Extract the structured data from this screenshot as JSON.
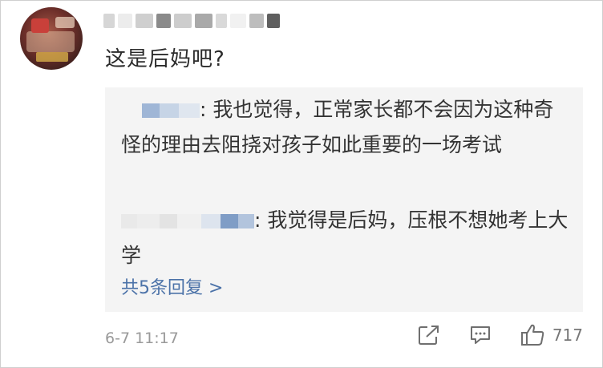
{
  "comment": {
    "text": "这是后妈吧?",
    "timestamp": "6-7  11:17",
    "like_count": "717"
  },
  "replies": [
    {
      "text": ": 我也觉得，正常家长都不会因为这种奇怪的理由去阻挠对孩子如此重要的一场考试"
    },
    {
      "text": ": 我觉得是后妈，压根不想她考上大学"
    }
  ],
  "more_replies_label": "共5条回复 >",
  "icons": {
    "share": "share-icon",
    "reply": "comment-icon",
    "like": "thumbs-up-icon"
  },
  "colors": {
    "link": "#4b72a8",
    "reply_bg": "#f4f4f4",
    "meta": "#9a9a9a"
  }
}
